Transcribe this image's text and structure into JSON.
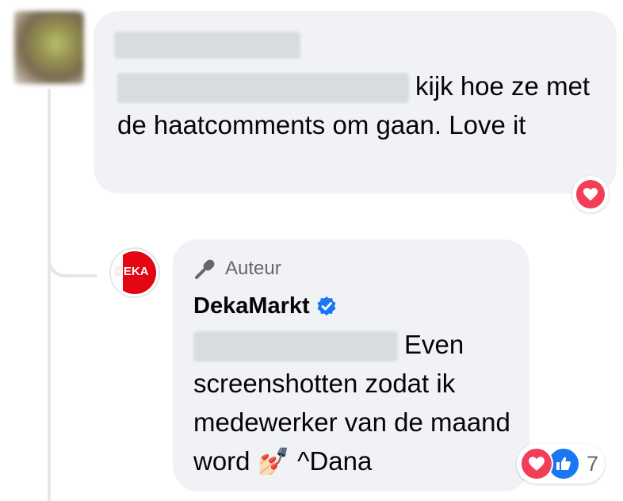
{
  "comment1": {
    "text": "kijk hoe ze met de haatcomments om gaan. Love it",
    "reaction": "heart-icon"
  },
  "reply": {
    "badge_label": "Auteur",
    "badge_icon": "microphone-icon",
    "page_name": "DekaMarkt",
    "verified_icon": "verified-badge-icon",
    "logo_text": "DEKA",
    "text": "Even screenshotten zodat ik medewerker van de maand word 💅🏻 ^Dana",
    "reactions": [
      "heart-icon",
      "thumbs-up-icon"
    ],
    "reaction_count": "7"
  },
  "colors": {
    "bubble": "#f0f2f5",
    "muted": "#65676b",
    "love": "#f33e58",
    "like": "#1877f2",
    "deka_red": "#e30613"
  }
}
